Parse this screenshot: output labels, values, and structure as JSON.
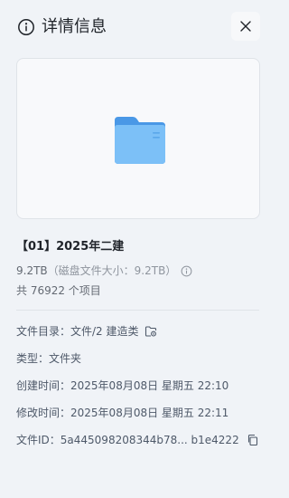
{
  "header": {
    "title": "详情信息",
    "info_icon": "info-circle-icon",
    "close_icon": "close-icon"
  },
  "preview": {
    "icon": "folder-icon",
    "folder_color": "#5aaaf0"
  },
  "item": {
    "name": "【01】2025年二建",
    "size": "9.2TB",
    "disk_size_note": "（磁盘文件大小：9.2TB）",
    "item_count": "共 76922 个项目"
  },
  "details": {
    "directory_label": "文件目录：",
    "directory_value": "文件/2 建造类",
    "type_label": "类型：",
    "type_value": "文件夹",
    "created_label": "创建时间：",
    "created_value": "2025年08月08日 星期五 22:10",
    "modified_label": "修改时间：",
    "modified_value": "2025年08月08日 星期五 22:11",
    "file_id_label": "文件ID：",
    "file_id_value": "5a445098208344b78... b1e4222"
  }
}
